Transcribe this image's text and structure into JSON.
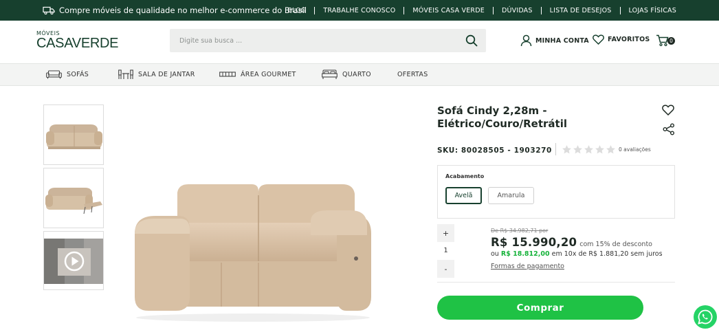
{
  "topbar": {
    "promo": "Compre móveis de qualidade no melhor e-commerce do Brasil",
    "links": [
      "BLOG",
      "TRABALHE CONOSCO",
      "MÓVEIS CASA VERDE",
      "DÚVIDAS",
      "LISTA DE DESEJOS",
      "LOJAS FÍSICAS"
    ]
  },
  "header": {
    "logo_small": "MÓVEIS",
    "logo_big": "CASAVERDE",
    "search_placeholder": "Digite sua busca ...",
    "account_label": "MINHA CONTA",
    "favorites_label": "FAVORITOS",
    "cart_count": "0"
  },
  "nav": {
    "items": [
      "SOFÁS",
      "SALA DE JANTAR",
      "ÁREA GOURMET",
      "QUARTO",
      "OFERTAS"
    ]
  },
  "product": {
    "title_line1": "Sofá Cindy 2,28m -",
    "title_line2": "Elétrico/Couro/Retrátil",
    "sku": "SKU: 80028505 - 1903270",
    "rating": 0,
    "reviews_label": "0 avaliações",
    "finish_label": "Acabamento",
    "finish_options": [
      "Avelã",
      "Amarula"
    ],
    "finish_selected": "Avelã",
    "quantity": "1",
    "qty_plus": "+",
    "qty_minus": "-",
    "old_price": "De R$ 34.982,71 por",
    "price": "R$ 15.990,20",
    "discount": "com 15% de desconto",
    "installment_prefix": "ou",
    "installment_total": "R$ 18.812,00",
    "installment_suffix": "em 10x de R$ 1.881,20 sem juros",
    "payment_link": "Formas de pagamento",
    "buy_label": "Comprar"
  },
  "colors": {
    "brand_dark": "#17402e",
    "buy_green": "#1fc245",
    "installment_green": "#17b33b",
    "whatsapp": "#25d366"
  },
  "icons": [
    "truck-icon",
    "search-icon",
    "user-icon",
    "heart-icon",
    "cart-icon",
    "sofa-icon",
    "dining-icon",
    "grill-icon",
    "bed-icon",
    "share-icon",
    "star-icon",
    "play-icon",
    "whatsapp-icon"
  ]
}
